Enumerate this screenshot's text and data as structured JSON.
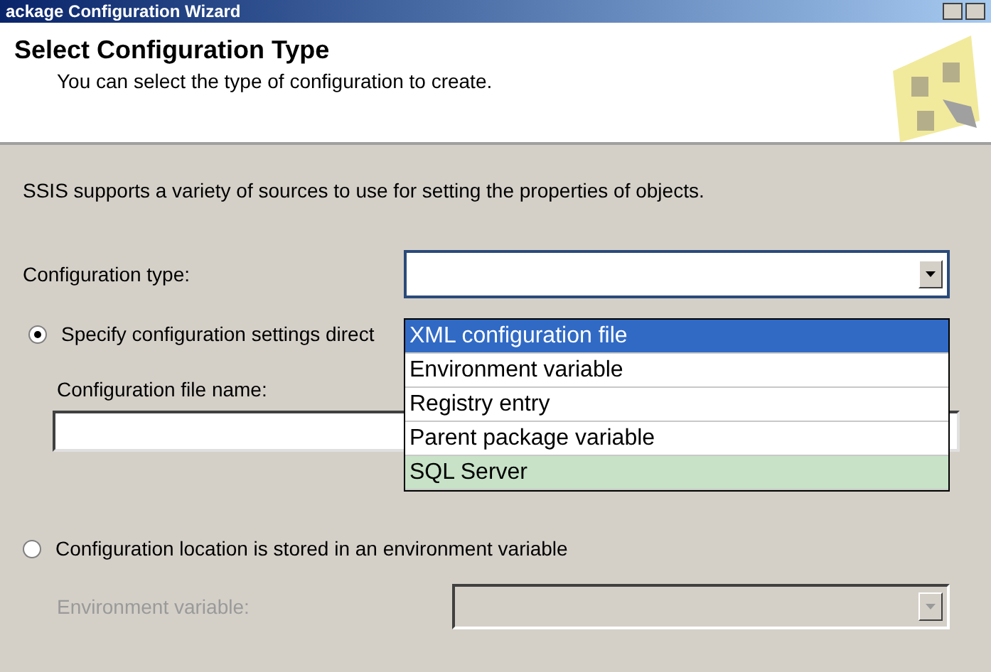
{
  "window": {
    "title": "ackage Configuration Wizard"
  },
  "header": {
    "title": "Select Configuration Type",
    "subtitle": "You can select the type of configuration to create."
  },
  "intro": "SSIS supports a variety of sources to use for setting the properties of objects.",
  "configuration_type": {
    "label": "Configuration type:",
    "expanded": true,
    "options": [
      {
        "label": "XML configuration file",
        "selected": true,
        "hovered": false
      },
      {
        "label": "Environment variable",
        "selected": false,
        "hovered": false
      },
      {
        "label": "Registry entry",
        "selected": false,
        "hovered": false
      },
      {
        "label": "Parent package variable",
        "selected": false,
        "hovered": false
      },
      {
        "label": "SQL Server",
        "selected": false,
        "hovered": true
      }
    ]
  },
  "direct_option": {
    "label": "Specify configuration settings direct",
    "selected": true
  },
  "file_name": {
    "label": "Configuration file name:"
  },
  "env_option": {
    "label": "Configuration location is stored in an environment variable",
    "selected": false
  },
  "environment_variable": {
    "label": "Environment variable:",
    "disabled": true
  }
}
